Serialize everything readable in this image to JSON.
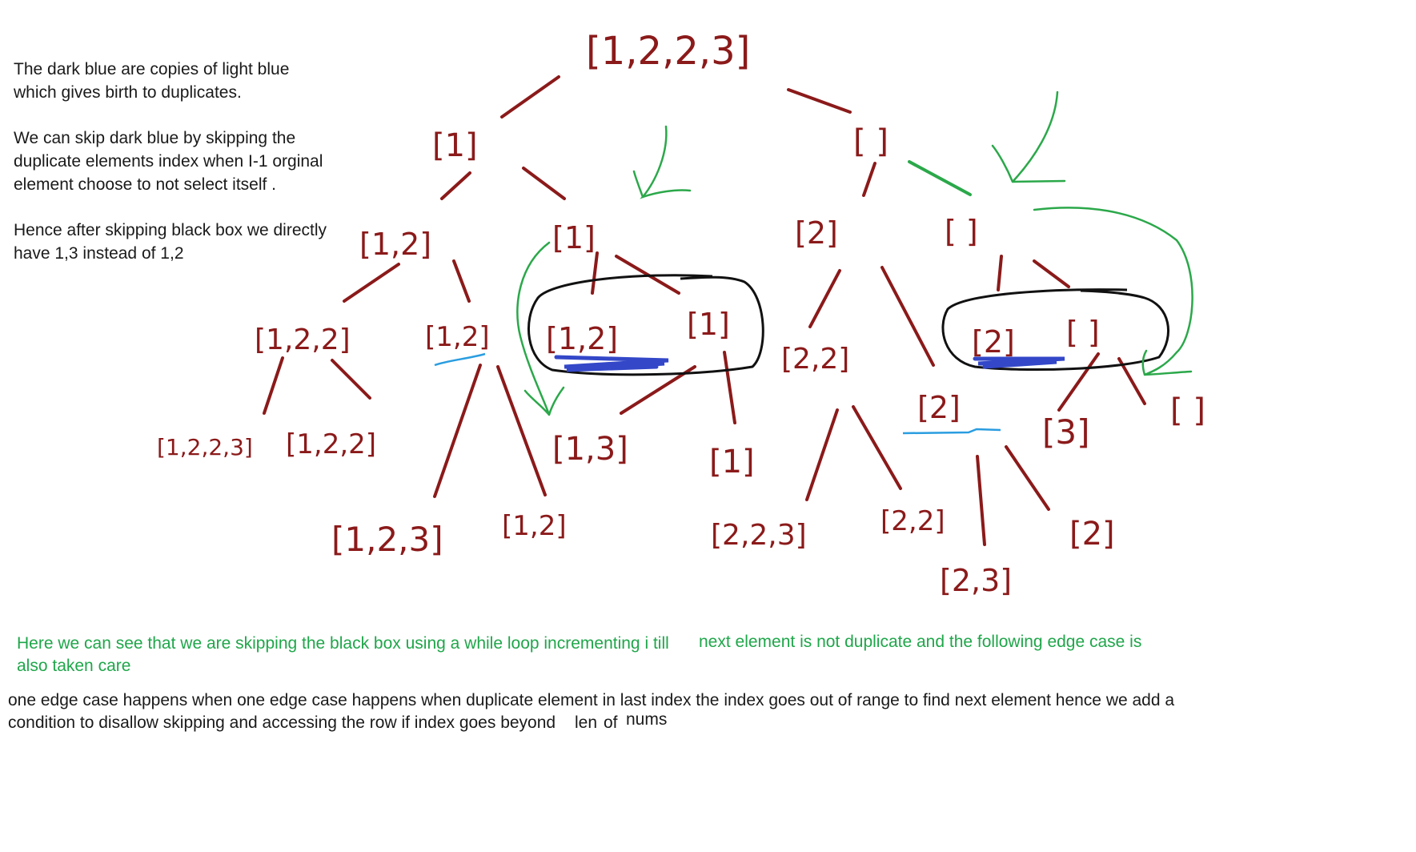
{
  "notes": {
    "line1": "The dark blue are copies of light blue",
    "line2": "which gives birth to duplicates.",
    "line3": "We can skip dark blue by skipping the",
    "line4": "duplicate elements index when I-1 orginal",
    "line5": "element choose to not select itself .",
    "line6": "Hence after skipping black box we directly",
    "line7": "have 1,3 instead of 1,2"
  },
  "green_note": {
    "line1a": "Here we can see that we are skipping the black box using a while loop incrementing i till",
    "line1b": "next element is not duplicate and the following edge case is",
    "line2": "also taken care"
  },
  "edge_note": {
    "line1": "one edge case happens when one edge case happens when duplicate element in last index the index goes out of range to find next element hence we add a",
    "line2a": "condition to disallow skipping and accessing the row if index goes beyond",
    "line2b": "len",
    "line2c": "of",
    "line2d": "nums"
  },
  "tree": {
    "root": "[1,2,2,3]",
    "n_1": "[1]",
    "n_empty_a": "[ ]",
    "n_12": "[1,2]",
    "n_1b": "[1]",
    "n_2": "[2]",
    "n_empty_b": "[ ]",
    "n_122": "[1,2,2]",
    "n_12b": "[1,2]",
    "n_12c": "[1,2]",
    "n_1c": "[1]",
    "n_22": "[2,2]",
    "n_2b": "[2]",
    "n_2c": "[2]",
    "n_empty_c": "[ ]",
    "n_1223": "[1,2,2,3]",
    "n_122b": "[1,2,2]",
    "n_123": "[1,2,3]",
    "n_12d": "[1,2]",
    "n_13": "[1,3]",
    "n_1d": "[1]",
    "n_223": "[2,2,3]",
    "n_22b": "[2,2]",
    "n_23": "[2,3]",
    "n_2d": "[2]",
    "n_3": "[3]",
    "n_empty_d": "[ ]"
  },
  "colors": {
    "tree_ink": "#8b1a1a",
    "note_green": "#1fa64a",
    "dark_blue": "#3347c8",
    "light_blue": "#2a9de0",
    "box": "#111111"
  }
}
